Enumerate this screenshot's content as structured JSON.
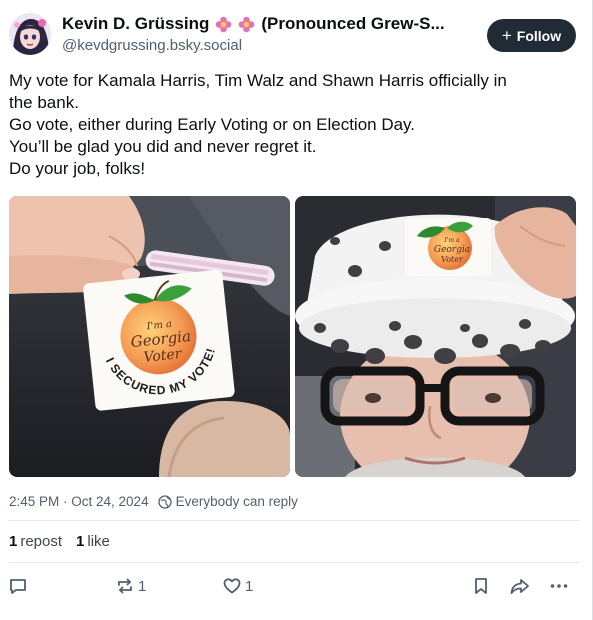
{
  "author": {
    "name": "Kevin D. Grüssing",
    "display_suffix": "(Pronounced Grew-S...",
    "handle": "@kevdgrussing.bsky.social",
    "avatar_icon": "avatar-illustration"
  },
  "follow_button": {
    "label": "Follow",
    "icon": "plus-icon"
  },
  "post": {
    "lines": [
      "My vote for Kamala Harris, Tim Walz and Shawn Harris officially in",
      "the bank.",
      "Go vote, either during Early Voting or on Election Day.",
      "You’ll be glad you did and never regret it.",
      "Do your job, folks!"
    ]
  },
  "images": [
    {
      "name": "sticker-photo",
      "sticker": {
        "line1": "I'm a",
        "line2": "Georgia",
        "line3": "Voter",
        "arc": "I SECURED MY VOTE!"
      }
    },
    {
      "name": "selfie-photo",
      "sticker": {
        "line1": "I'm a",
        "line2": "Georgia",
        "line3": "Voter"
      }
    }
  ],
  "meta": {
    "timestamp": "2:45 PM · Oct 24, 2024",
    "reply_setting": "Everybody can reply"
  },
  "stats": {
    "reposts_count": "1",
    "reposts_label": "repost",
    "likes_count": "1",
    "likes_label": "like"
  },
  "actions": {
    "reply_icon": "reply-icon",
    "repost_icon": "repost-icon",
    "repost_count": "1",
    "like_icon": "heart-icon",
    "like_count": "1",
    "bookmark_icon": "bookmark-icon",
    "share_icon": "share-icon",
    "more_icon": "more-icon"
  },
  "colors": {
    "text": "#0b0f14",
    "secondary": "#51606e",
    "follow_bg": "#202b35",
    "divider": "#e3e7ec"
  }
}
